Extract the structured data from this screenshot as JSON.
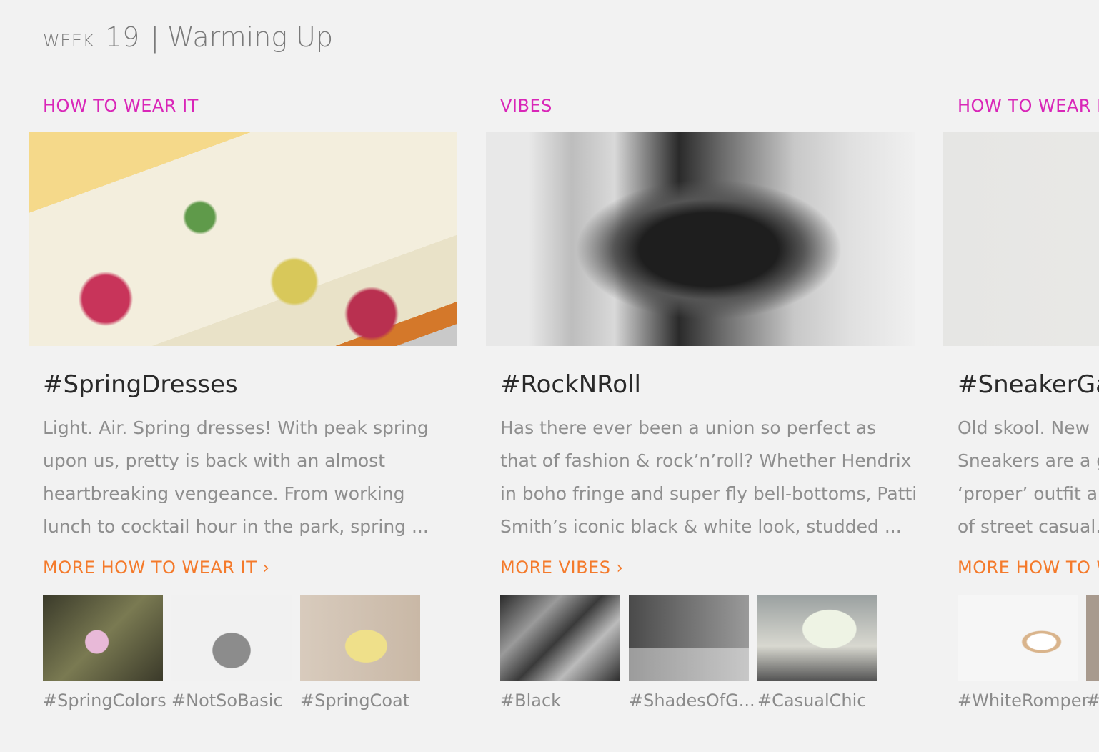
{
  "header": {
    "week_label": "WEEK",
    "week_number": "19",
    "separator": "|",
    "title": "Warming Up"
  },
  "colors": {
    "category": "#d926b8",
    "more_link": "#f47a2b",
    "background": "#f2f2f2"
  },
  "cards": [
    {
      "category": "HOW TO WEAR IT",
      "title": "#SpringDresses",
      "description": [
        "Light. Air. Spring dresses! With peak spring",
        "upon us, pretty is back with an almost",
        "heartbreaking vengeance. From working",
        "lunch to cocktail hour in the park, spring ..."
      ],
      "more_link": "MORE HOW TO WEAR IT ›",
      "tags": [
        "#SpringColors",
        "#NotSoBasic",
        "#SpringCoat"
      ]
    },
    {
      "category": "VIBES",
      "title": "#RockNRoll",
      "description": [
        "Has there ever been a union so perfect as",
        "that of fashion & rock’n’roll? Whether Hendrix",
        "in boho fringe and super fly bell-bottoms, Patti",
        "Smith’s iconic black & white look, studded ..."
      ],
      "more_link": "MORE VIBES ›",
      "tags": [
        "#Black",
        "#ShadesOfG...",
        "#CasualChic"
      ]
    },
    {
      "category": "HOW TO WEAR IT",
      "title": "#SneakerGa",
      "description": [
        "Old skool. New",
        "Sneakers are a g",
        "‘proper’ outfit ar",
        "of street casual."
      ],
      "more_link": "MORE HOW TO W",
      "tags": [
        "#WhiteRomper",
        "#"
      ]
    }
  ]
}
